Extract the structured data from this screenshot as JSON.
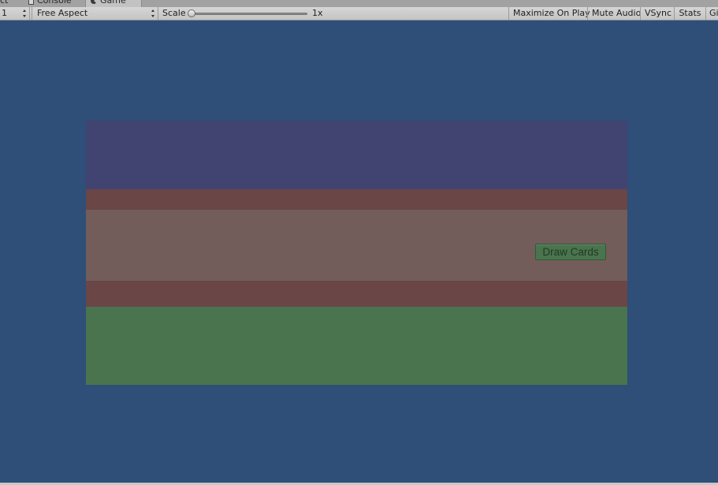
{
  "tabs": {
    "project_label": "ct",
    "console_label": "Console",
    "game_label": "Game"
  },
  "toolbar": {
    "display_value": "1",
    "aspect_value": "Free Aspect",
    "scale_label": "Scale",
    "scale_value": "1x",
    "maximize_on_play_label": "Maximize On Play",
    "mute_audio_label": "Mute Audio",
    "vsync_label": "VSync",
    "stats_label": "Stats",
    "gizmos_label": "Gizmos"
  },
  "game": {
    "draw_button_label": "Draw Cards"
  },
  "colors": {
    "viewport_background": "#2f4e78",
    "opponent_area": "#414470",
    "divider": "#6a4647",
    "table_area": "#725d5a",
    "player_area": "#4a744e"
  }
}
